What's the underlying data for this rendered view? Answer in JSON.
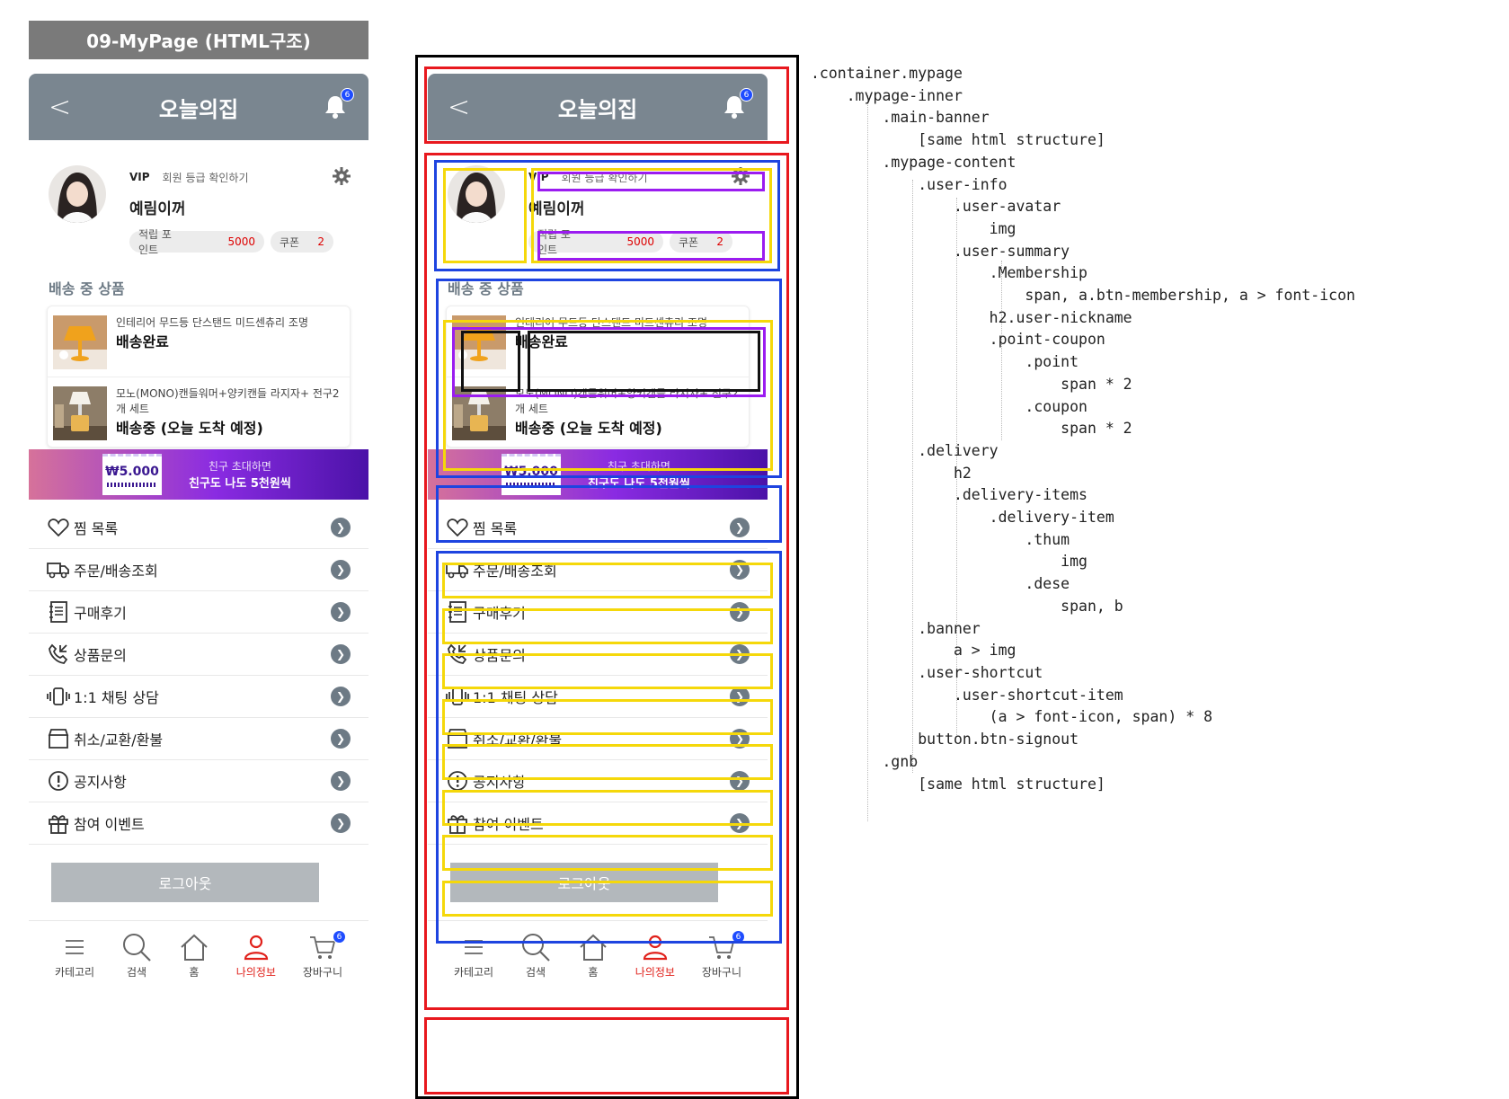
{
  "page_title": "09-MyPage (HTML구조)",
  "header": {
    "back": "<",
    "title": "오늘의집",
    "bell_badge": "6"
  },
  "user": {
    "grade": "VIP",
    "grade_link": "회원 등급 확인하기",
    "nickname": "예림이꺼",
    "point_label": "적립 포인트",
    "point_value": "5000",
    "coupon_label": "쿠폰",
    "coupon_value": "2"
  },
  "delivery": {
    "heading": "배송 중 상품",
    "items": [
      {
        "name": "인테리어 무드등 단스탠드 미드센츄리 조명",
        "status": "배송완료"
      },
      {
        "name": "모노(MONO)캔들워머+양키캔들 라지자+ 전구2개 세트",
        "status": "배송중 (오늘 도착 예정)"
      }
    ]
  },
  "banner": {
    "ticket_amount": "₩5.000",
    "line1": "친구 초대하면",
    "line2": "친구도 나도 5천원씩"
  },
  "shortcuts": [
    {
      "icon": "heart-icon",
      "label": "찜 목록"
    },
    {
      "icon": "truck-icon",
      "label": "주문/배송조회"
    },
    {
      "icon": "notebook-icon",
      "label": "구매후기"
    },
    {
      "icon": "phone-call-icon",
      "label": "상품문의"
    },
    {
      "icon": "vibrate-phone-icon",
      "label": "1:1 채팅 상담"
    },
    {
      "icon": "box-icon",
      "label": "취소/교환/환불"
    },
    {
      "icon": "exclamation-icon",
      "label": "공지사항"
    },
    {
      "icon": "gift-icon",
      "label": "참여 이벤트"
    }
  ],
  "signout_label": "로그아웃",
  "gnb": [
    {
      "icon": "menu-icon",
      "label": "카테고리"
    },
    {
      "icon": "search-icon",
      "label": "검색"
    },
    {
      "icon": "home-icon",
      "label": "홈"
    },
    {
      "icon": "user-icon",
      "label": "나의정보",
      "active": true
    },
    {
      "icon": "cart-icon",
      "label": "장바구니",
      "badge": "6"
    }
  ],
  "tree": [
    ".container.mypage",
    "    .mypage-inner",
    "        .main-banner",
    "            [same html structure]",
    "        .mypage-content",
    "            .user-info",
    "                .user-avatar",
    "                    img",
    "                .user-summary",
    "                    .Membership",
    "                        span, a.btn-membership, a > font-icon",
    "                    h2.user-nickname",
    "                    .point-coupon",
    "                        .point",
    "                            span * 2",
    "                        .coupon",
    "                            span * 2",
    "            .delivery",
    "                h2",
    "                .delivery-items",
    "                    .delivery-item",
    "                        .thum",
    "                            img",
    "                        .dese",
    "                            span, b",
    "            .banner",
    "                a > img",
    "            .user-shortcut",
    "                .user-shortcut-item",
    "                    (a > font-icon, span) * 8",
    "            button.btn-signout",
    "        .gnb",
    "            [same html structure]"
  ],
  "colors": {
    "header": "#7a8690",
    "accent_red": "#e0201a",
    "badge_blue": "#1e4cff",
    "annot_red": "#e8181e",
    "annot_blue": "#1e44e0",
    "annot_yellow": "#f5d80a",
    "annot_purple": "#9b1cf0"
  }
}
